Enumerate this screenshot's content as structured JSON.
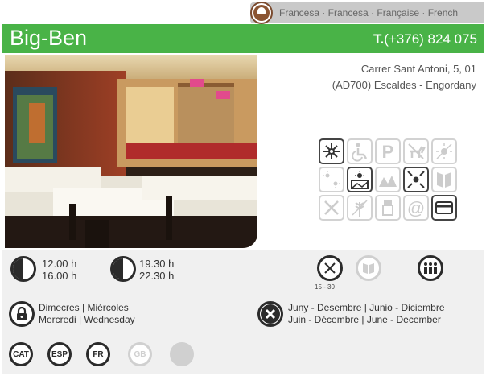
{
  "cuisine": {
    "label": "Francesa · Francesa · Française · French"
  },
  "header": {
    "name": "Big-Ben",
    "phone_prefix": "T.",
    "phone": "(+376) 824 075"
  },
  "address": {
    "line1": "Carrer Sant Antoni, 5, 01",
    "line2": "(AD700) Escaldes - Engordany"
  },
  "services": [
    {
      "icon": "air-conditioning-icon",
      "active": true
    },
    {
      "icon": "wheelchair-accessible-icon",
      "active": false
    },
    {
      "icon": "parking-icon",
      "active": false
    },
    {
      "icon": "pets-allowed-icon",
      "active": false
    },
    {
      "icon": "terrace-icon",
      "active": false
    },
    {
      "icon": "outdoor-icon",
      "active": false
    },
    {
      "icon": "view-icon",
      "active": true
    },
    {
      "icon": "mountain-view-icon",
      "active": false
    },
    {
      "icon": "reservations-icon",
      "active": true
    },
    {
      "icon": "menu-icon",
      "active": false
    },
    {
      "icon": "cutlery-icon",
      "active": false
    },
    {
      "icon": "grain-icon",
      "active": false
    },
    {
      "icon": "takeaway-icon",
      "active": false
    },
    {
      "icon": "at-icon",
      "active": false
    },
    {
      "icon": "credit-card-icon",
      "active": true
    }
  ],
  "hours": {
    "lunch_open": "12.00 h",
    "lunch_close": "16.00 h",
    "dinner_open": "19.30 h",
    "dinner_close": "22.30 h"
  },
  "price": {
    "range": "15 - 30"
  },
  "closed_day": {
    "line1": "Dimecres | Miércoles",
    "line2": "Mercredi | Wednesday"
  },
  "closed_period": {
    "line1": "Juny - Desembre | Junio - Diciembre",
    "line2": "Juin - Décembre | June - December"
  },
  "languages": [
    {
      "code": "CAT",
      "active": true
    },
    {
      "code": "ESP",
      "active": true
    },
    {
      "code": "FR",
      "active": true
    },
    {
      "code": "GB",
      "active": false
    }
  ]
}
